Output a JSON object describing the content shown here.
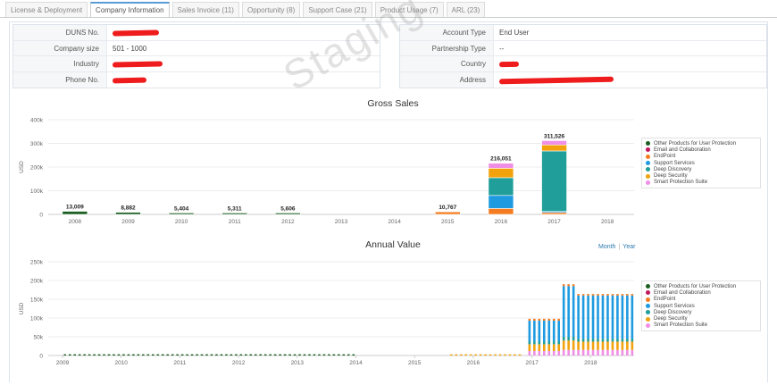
{
  "tabs": [
    {
      "label": "License & Deployment"
    },
    {
      "label": "Company Information",
      "active": true
    },
    {
      "label": "Sales Invoice (11)"
    },
    {
      "label": "Opportunity (8)"
    },
    {
      "label": "Support Case (21)"
    },
    {
      "label": "Product Usage (7)"
    },
    {
      "label": "ARL (23)"
    }
  ],
  "company_info": {
    "left": [
      {
        "label": "DUNS No.",
        "value": "",
        "redacted": true
      },
      {
        "label": "Company size",
        "value": "501 - 1000",
        "redacted": false
      },
      {
        "label": "Industry",
        "value": "",
        "redacted": true
      },
      {
        "label": "Phone No.",
        "value": "",
        "redacted": true
      }
    ],
    "right": [
      {
        "label": "Account Type",
        "value": "End User",
        "redacted": false
      },
      {
        "label": "Partnership Type",
        "value": "--",
        "redacted": false
      },
      {
        "label": "Country",
        "value": "",
        "redacted": true
      },
      {
        "label": "Address",
        "value": "",
        "redacted": true
      }
    ]
  },
  "watermark": "Staging",
  "colors": {
    "redaction": "#ee1c1c",
    "active_tab_accent": "#5b9bd5",
    "link": "#2a7ab0"
  },
  "annual_value_toggle": {
    "month": "Month",
    "year": "Year"
  },
  "legend": [
    {
      "name": "Other Products for User Protection",
      "color": "#1b5e20"
    },
    {
      "name": "Email and Collaboration",
      "color": "#c2185b"
    },
    {
      "name": "EndPoint",
      "color": "#f57c20"
    },
    {
      "name": "Support Services",
      "color": "#1e9be0"
    },
    {
      "name": "Deep Discovery",
      "color": "#1f9e9a"
    },
    {
      "name": "Deep Security",
      "color": "#f2a20c"
    },
    {
      "name": "Smart Protection Suite",
      "color": "#f08ee6"
    }
  ],
  "chart_data": [
    {
      "type": "bar",
      "title": "Gross Sales",
      "ylabel": "USD",
      "ylim": [
        0,
        400000
      ],
      "yticks": [
        "0",
        "100k",
        "200k",
        "300k",
        "400k"
      ],
      "categories": [
        "2008",
        "2009",
        "2010",
        "2011",
        "2012",
        "2013",
        "2014",
        "2015",
        "2016",
        "2017",
        "2018"
      ],
      "totals_labels": [
        "13,009",
        "8,882",
        "5,404",
        "5,311",
        "5,606",
        "",
        "",
        "10,767",
        "216,051",
        "311,526",
        ""
      ],
      "series": [
        {
          "name": "Other Products for User Protection",
          "values": [
            13009,
            8882,
            5404,
            5311,
            5606,
            0,
            0,
            0,
            0,
            0,
            0
          ]
        },
        {
          "name": "Email and Collaboration",
          "values": [
            0,
            0,
            0,
            0,
            0,
            0,
            0,
            0,
            0,
            0,
            0
          ]
        },
        {
          "name": "EndPoint",
          "values": [
            0,
            0,
            0,
            0,
            0,
            0,
            0,
            10767,
            25000,
            8000,
            0
          ]
        },
        {
          "name": "Support Services",
          "values": [
            0,
            0,
            0,
            0,
            0,
            0,
            0,
            0,
            55000,
            5000,
            0
          ]
        },
        {
          "name": "Deep Discovery",
          "values": [
            0,
            0,
            0,
            0,
            0,
            0,
            0,
            0,
            75000,
            255000,
            0
          ]
        },
        {
          "name": "Deep Security",
          "values": [
            0,
            0,
            0,
            0,
            0,
            0,
            0,
            0,
            40000,
            25526,
            0
          ]
        },
        {
          "name": "Smart Protection Suite",
          "values": [
            0,
            0,
            0,
            0,
            0,
            0,
            0,
            0,
            21051,
            18000,
            0
          ]
        }
      ],
      "legend_position": "right"
    },
    {
      "type": "bar",
      "title": "Annual Value",
      "ylabel": "USD",
      "ylim": [
        0,
        250000
      ],
      "yticks": [
        "0",
        "50k",
        "100k",
        "150k",
        "200k",
        "250k"
      ],
      "categories": [
        "2009",
        "2010",
        "2011",
        "2012",
        "2013",
        "2014",
        "2015",
        "2016",
        "2017",
        "2018"
      ],
      "granularity": "monthly",
      "legend_position": "right"
    }
  ]
}
